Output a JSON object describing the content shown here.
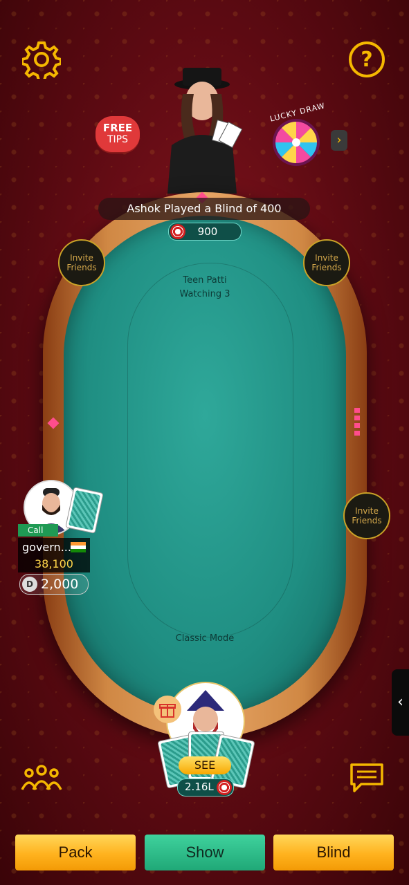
{
  "notice": "Ashok Played a Blind of 400",
  "pot": "900",
  "table": {
    "game_name": "Teen Patti",
    "watching": "Watching 3",
    "mode": "Classic Mode"
  },
  "free_tips": {
    "line1": "FREE",
    "line2": "TIPS"
  },
  "lucky_draw": "LUCKY DRAW",
  "invite_label": "Invite Friends",
  "player": {
    "status": "Call",
    "name": "govern...",
    "chips": "38,100",
    "balance": "2,000"
  },
  "self": {
    "see_label": "SEE",
    "amount": "2.16L"
  },
  "actions": {
    "pack": "Pack",
    "show": "Show",
    "blind": "Blind"
  },
  "icons": {
    "settings": "gear-icon",
    "help": "question-icon",
    "players": "users-icon",
    "chat": "chat-icon",
    "gift": "gift-icon",
    "side": "chevron-left-icon"
  },
  "colors": {
    "gold": "#f5b800",
    "felt": "#1f8e82",
    "background": "#5c0a12"
  }
}
